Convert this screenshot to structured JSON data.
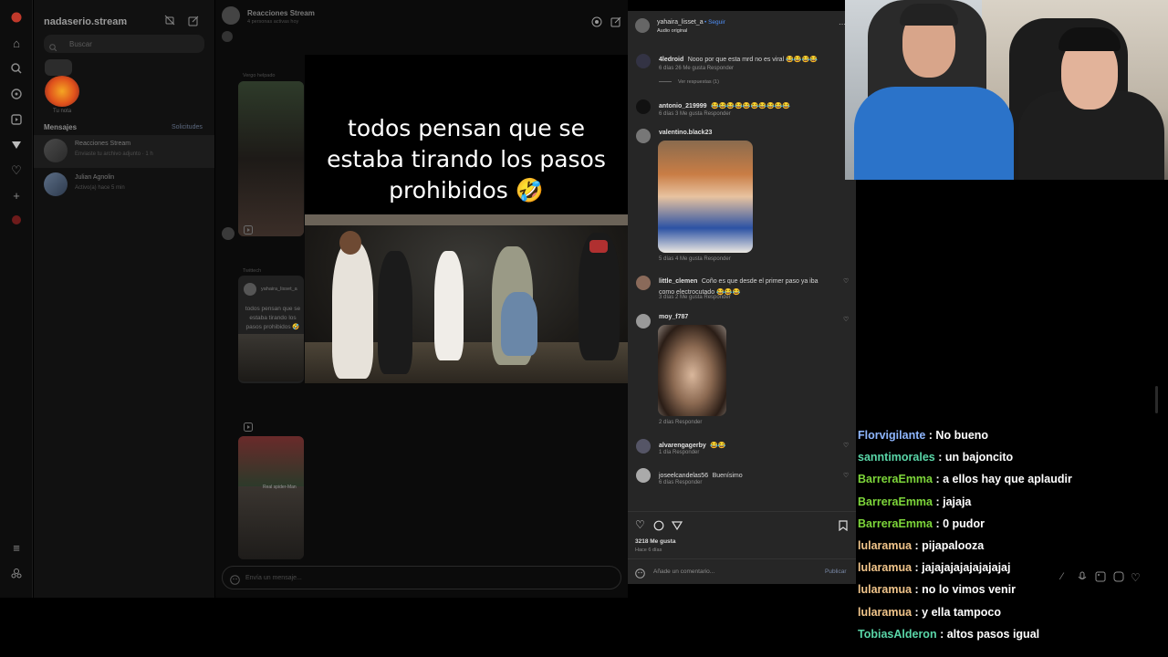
{
  "dm": {
    "username": "nadaserio.stream",
    "search_placeholder": "Buscar",
    "note_label": "Tu nota",
    "messages_label": "Mensajes",
    "requests_label": "Solicitudes",
    "conversations": [
      {
        "name": "Reacciones Stream",
        "sub": "Enviaste tu archivo adjunto · 1 h"
      },
      {
        "name": "Julian Agnolin",
        "sub": "Activo(a) hace 5 min"
      }
    ]
  },
  "chat": {
    "title": "Reacciones Stream",
    "subtitle": "4 personas activas hoy",
    "label_seen": "Vergo helpado",
    "label_twitch": "Twittech",
    "shared_user": "yahaira_lisset_a",
    "shared_caption": "todos pensan que se estaba tirando los pasos prohibidos 🤣",
    "shared_reel_label": "Real spider-Man",
    "input_placeholder": "Envía un mensaje..."
  },
  "video": {
    "caption_lines": [
      "todos pensan que se",
      "estaba tirando los pasos",
      "prohibidos 🤣"
    ]
  },
  "post": {
    "author": "yahaira_lisset_a",
    "follow_label": "Seguir",
    "audio_label": "Audio original",
    "comments": [
      {
        "user": "4ledroid",
        "text": "Nooo por que esta mrd no es viral 😂😂😂😂",
        "meta": "6 días   26 Me gusta   Responder"
      },
      {
        "user": "antonio_219999",
        "text": "😂😂😂😂😂😂😂😂😂😂",
        "meta": "6 días   3 Me gusta   Responder"
      },
      {
        "user": "valentino.black23",
        "text": "",
        "meta": "5 días   4 Me gusta   Responder"
      },
      {
        "user": "little_clemen",
        "text": "Coño es que desde el primer paso ya iba como electrocutado 😂😂😂",
        "meta": "3 días   2 Me gusta   Responder"
      },
      {
        "user": "moy_f787",
        "text": "",
        "meta": "2 días   Responder"
      },
      {
        "user": "alvarengagerby",
        "text": "😂😂",
        "meta": "1 día   Responder"
      },
      {
        "user": "joseelcandelas56",
        "text": "Buenísimo",
        "meta": "6 días   Responder"
      }
    ],
    "view_replies": "Ver respuestas (1)",
    "likes": "3218 Me gusta",
    "posted": "Hace 6 días",
    "comment_placeholder": "Añade un comentario...",
    "publish_label": "Publicar"
  },
  "stream_chat": [
    {
      "user": "Florvigilante",
      "text": " : No bueno",
      "color": "#8fb7ff"
    },
    {
      "user": "sanntimorales",
      "text": " : un bajoncito",
      "color": "#5ad6a8"
    },
    {
      "user": "BarreraEmma",
      "text": " : a ellos hay que aplaudir",
      "color": "#7dd63a"
    },
    {
      "user": "BarreraEmma",
      "text": " : jajaja",
      "color": "#7dd63a"
    },
    {
      "user": "BarreraEmma",
      "text": " : 0 pudor",
      "color": "#7dd63a"
    },
    {
      "user": "lularamua",
      "text": " : pijapalooza",
      "color": "#f0c48a"
    },
    {
      "user": "lularamua",
      "text": " : jajajajajajajajajaj",
      "color": "#f0c48a"
    },
    {
      "user": "lularamua",
      "text": " : no lo vimos venir",
      "color": "#f0c48a"
    },
    {
      "user": "lularamua",
      "text": " : y ella tampoco",
      "color": "#f0c48a"
    },
    {
      "user": "TobiasAlderon",
      "text": " : altos pasos igual",
      "color": "#5ad6a8"
    }
  ]
}
